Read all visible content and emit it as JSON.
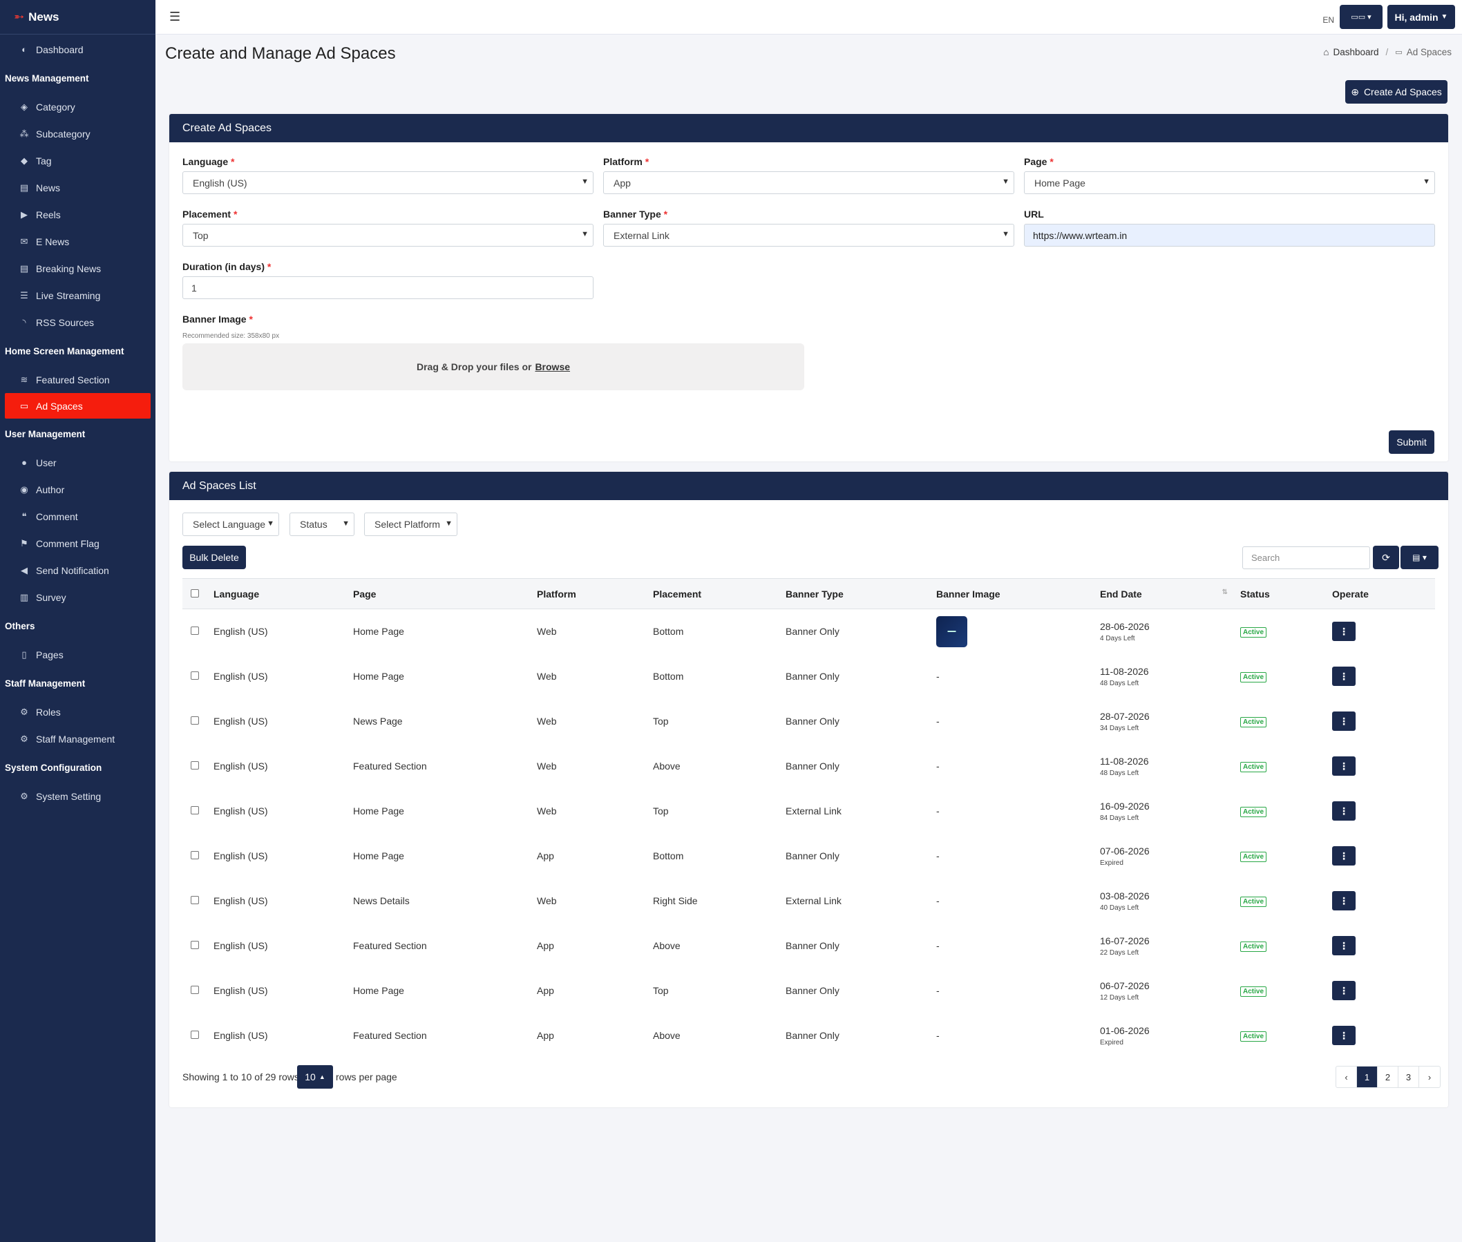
{
  "brand": {
    "name": "News",
    "icon": "rocket-icon"
  },
  "sidebar": {
    "dashboard": "Dashboard",
    "sections": [
      {
        "title": "News Management",
        "items": [
          "Category",
          "Subcategory",
          "Tag",
          "News",
          "Reels",
          "E News",
          "Breaking News",
          "Live Streaming",
          "RSS Sources"
        ]
      },
      {
        "title": "Home Screen Management",
        "items": [
          "Featured Section",
          "Ad Spaces"
        ]
      },
      {
        "title": "User Management",
        "items": [
          "User",
          "Author",
          "Comment",
          "Comment Flag",
          "Send Notification",
          "Survey"
        ]
      },
      {
        "title": "Others",
        "items": [
          "Pages"
        ]
      },
      {
        "title": "Staff Management",
        "items": [
          "Roles",
          "Staff Management"
        ]
      },
      {
        "title": "System Configuration",
        "items": [
          "System Setting"
        ]
      }
    ],
    "active_item": "Ad Spaces",
    "accent": "#f51d0d",
    "bg": "#1b2a4e"
  },
  "topbar": {
    "lang": "EN",
    "user_label": "Hi, admin"
  },
  "page": {
    "title": "Create and Manage Ad Spaces",
    "breadcrumb_home": "Dashboard",
    "breadcrumb_current": "Ad Spaces",
    "create_button": "Create Ad Spaces"
  },
  "form": {
    "header": "Create Ad Spaces",
    "language": {
      "label": "Language",
      "value": "English (US)"
    },
    "platform": {
      "label": "Platform",
      "value": "App"
    },
    "page": {
      "label": "Page",
      "value": "Home Page"
    },
    "placement": {
      "label": "Placement",
      "value": "Top"
    },
    "banner_type": {
      "label": "Banner Type",
      "value": "External Link"
    },
    "url": {
      "label": "URL",
      "value": "https://www.wrteam.in"
    },
    "duration": {
      "label": "Duration (in days)",
      "value": "1"
    },
    "banner_image": {
      "label": "Banner Image",
      "hint": "Recommended size: 358x80 px",
      "drop_text": "Drag & Drop your files or",
      "browse": "Browse"
    },
    "required_mark": "*",
    "submit": "Submit"
  },
  "list": {
    "header": "Ad Spaces List",
    "filters": {
      "language": "Select Language",
      "status": "Status",
      "platform": "Select Platform"
    },
    "bulk_delete": "Bulk Delete",
    "search_placeholder": "Search",
    "columns": [
      "Language",
      "Page",
      "Platform",
      "Placement",
      "Banner Type",
      "Banner Image",
      "End Date",
      "Status",
      "Operate"
    ],
    "rows": [
      {
        "language": "English (US)",
        "page": "Home Page",
        "platform": "Web",
        "placement": "Bottom",
        "banner_type": "Banner Only",
        "image": "thumb",
        "end_date": "28-06-2026",
        "left": "4 Days Left",
        "status": "Active"
      },
      {
        "language": "English (US)",
        "page": "Home Page",
        "platform": "Web",
        "placement": "Bottom",
        "banner_type": "Banner Only",
        "image": "-",
        "end_date": "11-08-2026",
        "left": "48 Days Left",
        "status": "Active"
      },
      {
        "language": "English (US)",
        "page": "News Page",
        "platform": "Web",
        "placement": "Top",
        "banner_type": "Banner Only",
        "image": "-",
        "end_date": "28-07-2026",
        "left": "34 Days Left",
        "status": "Active"
      },
      {
        "language": "English (US)",
        "page": "Featured Section",
        "platform": "Web",
        "placement": "Above",
        "banner_type": "Banner Only",
        "image": "-",
        "end_date": "11-08-2026",
        "left": "48 Days Left",
        "status": "Active"
      },
      {
        "language": "English (US)",
        "page": "Home Page",
        "platform": "Web",
        "placement": "Top",
        "banner_type": "External Link",
        "image": "-",
        "end_date": "16-09-2026",
        "left": "84 Days Left",
        "status": "Active"
      },
      {
        "language": "English (US)",
        "page": "Home Page",
        "platform": "App",
        "placement": "Bottom",
        "banner_type": "Banner Only",
        "image": "-",
        "end_date": "07-06-2026",
        "left": "Expired",
        "status": "Active"
      },
      {
        "language": "English (US)",
        "page": "News Details",
        "platform": "Web",
        "placement": "Right Side",
        "banner_type": "External Link",
        "image": "-",
        "end_date": "03-08-2026",
        "left": "40 Days Left",
        "status": "Active"
      },
      {
        "language": "English (US)",
        "page": "Featured Section",
        "platform": "App",
        "placement": "Above",
        "banner_type": "Banner Only",
        "image": "-",
        "end_date": "16-07-2026",
        "left": "22 Days Left",
        "status": "Active"
      },
      {
        "language": "English (US)",
        "page": "Home Page",
        "platform": "App",
        "placement": "Top",
        "banner_type": "Banner Only",
        "image": "-",
        "end_date": "06-07-2026",
        "left": "12 Days Left",
        "status": "Active"
      },
      {
        "language": "English (US)",
        "page": "Featured Section",
        "platform": "App",
        "placement": "Above",
        "banner_type": "Banner Only",
        "image": "-",
        "end_date": "01-06-2026",
        "left": "Expired",
        "status": "Active"
      }
    ],
    "footer": {
      "showing": "Showing 1 to 10 of 29 rows",
      "rows_per_page_value": "10",
      "rows_per_page_label": "rows per page"
    },
    "pagination": {
      "prev": "‹",
      "pages": [
        "1",
        "2",
        "3"
      ],
      "active": "1",
      "next": "›"
    }
  }
}
